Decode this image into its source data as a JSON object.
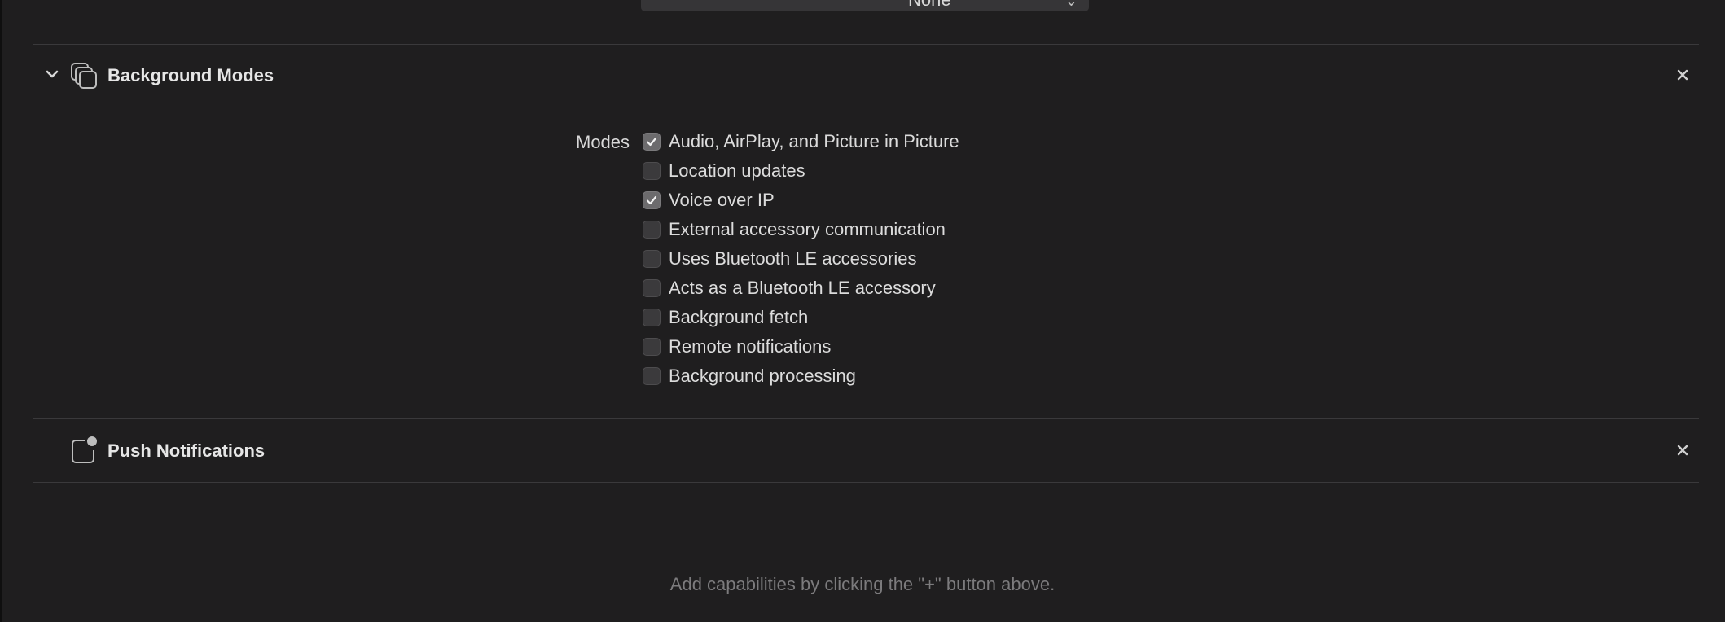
{
  "top_popup": {
    "value": "None"
  },
  "background_modes": {
    "title": "Background Modes",
    "modes_label": "Modes",
    "modes": [
      {
        "label": "Audio, AirPlay, and Picture in Picture",
        "checked": true
      },
      {
        "label": "Location updates",
        "checked": false
      },
      {
        "label": "Voice over IP",
        "checked": true
      },
      {
        "label": "External accessory communication",
        "checked": false
      },
      {
        "label": "Uses Bluetooth LE accessories",
        "checked": false
      },
      {
        "label": "Acts as a Bluetooth LE accessory",
        "checked": false
      },
      {
        "label": "Background fetch",
        "checked": false
      },
      {
        "label": "Remote notifications",
        "checked": false
      },
      {
        "label": "Background processing",
        "checked": false
      }
    ]
  },
  "push_notifications": {
    "title": "Push Notifications"
  },
  "hint": "Add capabilities by clicking the \"+\" button above.",
  "colors": {
    "background": "#1f1e1f",
    "divider": "#3a393b",
    "checkbox_checked": "#6c6b6d",
    "hint_text": "#7c7b7d"
  }
}
